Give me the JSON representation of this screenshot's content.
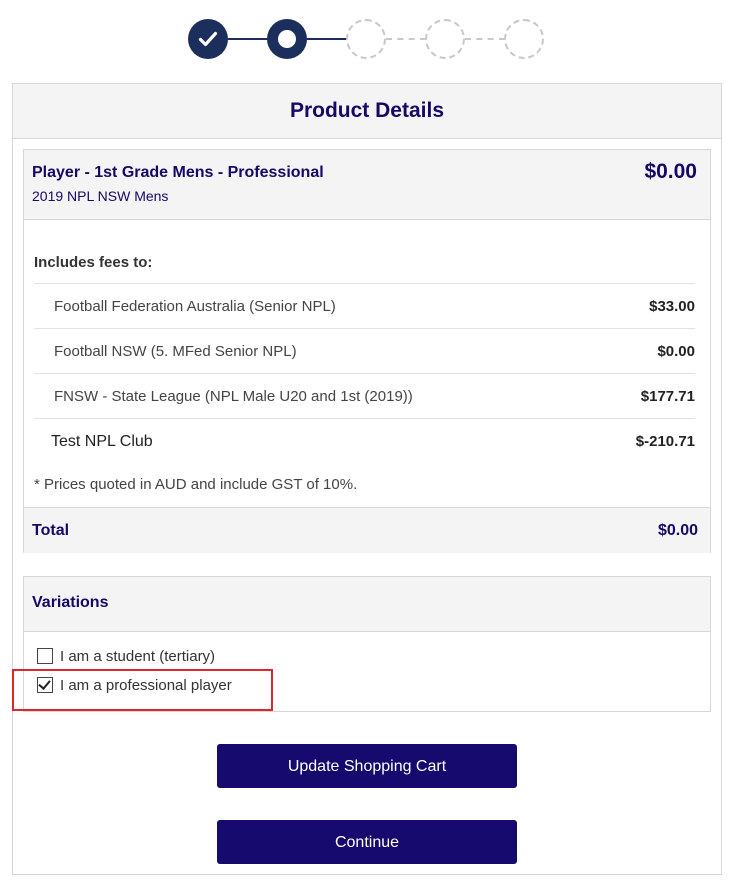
{
  "stepper": {
    "steps": [
      {
        "state": "completed",
        "icon": "check-icon"
      },
      {
        "state": "current",
        "icon": "dot-icon"
      },
      {
        "state": "pending"
      },
      {
        "state": "pending"
      },
      {
        "state": "pending"
      }
    ]
  },
  "header": {
    "title": "Product Details"
  },
  "product": {
    "name": "Player - 1st Grade Mens - Professional",
    "subtitle": "2019 NPL NSW Mens",
    "price": "$0.00"
  },
  "fees": {
    "title": "Includes fees to:",
    "items": [
      {
        "name": "Football Federation Australia (Senior NPL)",
        "amount": "$33.00"
      },
      {
        "name": "Football NSW (5. MFed Senior NPL)",
        "amount": "$0.00"
      },
      {
        "name": "FNSW - State League (NPL Male U20 and 1st (2019))",
        "amount": "$177.71"
      },
      {
        "name": "Test NPL Club",
        "amount": "$-210.71"
      }
    ],
    "note": "* Prices quoted in AUD and include GST of 10%."
  },
  "total": {
    "label": "Total",
    "amount": "$0.00"
  },
  "variations": {
    "title": "Variations",
    "options": [
      {
        "label": "I am a student (tertiary)",
        "checked": false
      },
      {
        "label": "I am a professional player",
        "checked": true
      }
    ]
  },
  "buttons": {
    "update_label": "Update Shopping Cart",
    "continue_label": "Continue"
  },
  "colors": {
    "primary": "#170a6e",
    "heading": "#160866",
    "stepper": "#1c2e5c",
    "highlight": "#e0262b"
  }
}
